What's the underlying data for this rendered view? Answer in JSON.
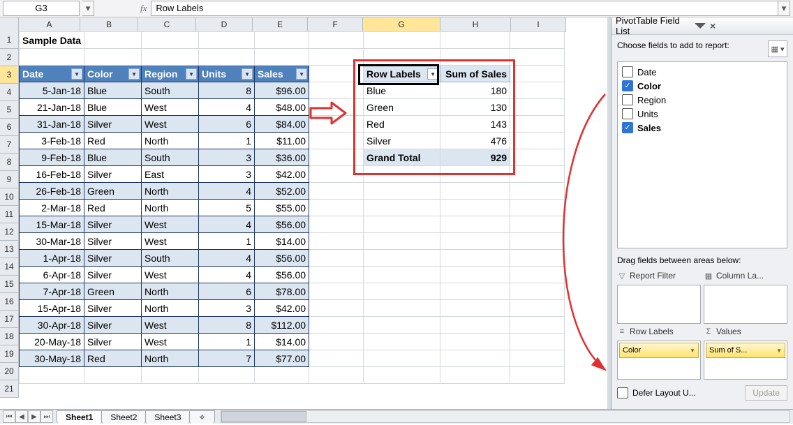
{
  "namebox": "G3",
  "formula": "Row Labels",
  "columns": [
    "A",
    "B",
    "C",
    "D",
    "E",
    "F",
    "G",
    "H",
    "I"
  ],
  "selected_col": "G",
  "selected_row": 3,
  "title_cell": "Sample Data",
  "headers": {
    "A": "Date",
    "B": "Color",
    "C": "Region",
    "D": "Units",
    "E": "Sales"
  },
  "data_rows": [
    {
      "A": "5-Jan-18",
      "B": "Blue",
      "C": "South",
      "D": "8",
      "E": "$96.00"
    },
    {
      "A": "21-Jan-18",
      "B": "Blue",
      "C": "West",
      "D": "4",
      "E": "$48.00"
    },
    {
      "A": "31-Jan-18",
      "B": "Silver",
      "C": "West",
      "D": "6",
      "E": "$84.00"
    },
    {
      "A": "3-Feb-18",
      "B": "Red",
      "C": "North",
      "D": "1",
      "E": "$11.00"
    },
    {
      "A": "9-Feb-18",
      "B": "Blue",
      "C": "South",
      "D": "3",
      "E": "$36.00"
    },
    {
      "A": "16-Feb-18",
      "B": "Silver",
      "C": "East",
      "D": "3",
      "E": "$42.00"
    },
    {
      "A": "26-Feb-18",
      "B": "Green",
      "C": "North",
      "D": "4",
      "E": "$52.00"
    },
    {
      "A": "2-Mar-18",
      "B": "Red",
      "C": "North",
      "D": "5",
      "E": "$55.00"
    },
    {
      "A": "15-Mar-18",
      "B": "Silver",
      "C": "West",
      "D": "4",
      "E": "$56.00"
    },
    {
      "A": "30-Mar-18",
      "B": "Silver",
      "C": "West",
      "D": "1",
      "E": "$14.00"
    },
    {
      "A": "1-Apr-18",
      "B": "Silver",
      "C": "South",
      "D": "4",
      "E": "$56.00"
    },
    {
      "A": "6-Apr-18",
      "B": "Silver",
      "C": "West",
      "D": "4",
      "E": "$56.00"
    },
    {
      "A": "7-Apr-18",
      "B": "Green",
      "C": "North",
      "D": "6",
      "E": "$78.00"
    },
    {
      "A": "15-Apr-18",
      "B": "Silver",
      "C": "North",
      "D": "3",
      "E": "$42.00"
    },
    {
      "A": "30-Apr-18",
      "B": "Silver",
      "C": "West",
      "D": "8",
      "E": "$112.00"
    },
    {
      "A": "20-May-18",
      "B": "Silver",
      "C": "West",
      "D": "1",
      "E": "$14.00"
    },
    {
      "A": "30-May-18",
      "B": "Red",
      "C": "North",
      "D": "7",
      "E": "$77.00"
    }
  ],
  "pivot": {
    "row_label_hdr": "Row Labels",
    "sum_hdr": "Sum of Sales",
    "rows": [
      {
        "label": "Blue",
        "val": "180"
      },
      {
        "label": "Green",
        "val": "130"
      },
      {
        "label": "Red",
        "val": "143"
      },
      {
        "label": "Silver",
        "val": "476"
      }
    ],
    "total_label": "Grand Total",
    "total_val": "929"
  },
  "panel": {
    "title": "PivotTable Field List",
    "choose": "Choose fields to add to report:",
    "fields": [
      {
        "name": "Date",
        "on": false
      },
      {
        "name": "Color",
        "on": true
      },
      {
        "name": "Region",
        "on": false
      },
      {
        "name": "Units",
        "on": false
      },
      {
        "name": "Sales",
        "on": true
      }
    ],
    "drag": "Drag fields between areas below:",
    "areas": {
      "filter": "Report Filter",
      "columns": "Column La...",
      "rows": "Row Labels",
      "values": "Values"
    },
    "row_chip": "Color",
    "val_chip": "Sum of S...",
    "defer": "Defer Layout U...",
    "update": "Update"
  },
  "tabs": [
    "Sheet1",
    "Sheet2",
    "Sheet3"
  ],
  "active_tab": "Sheet1"
}
